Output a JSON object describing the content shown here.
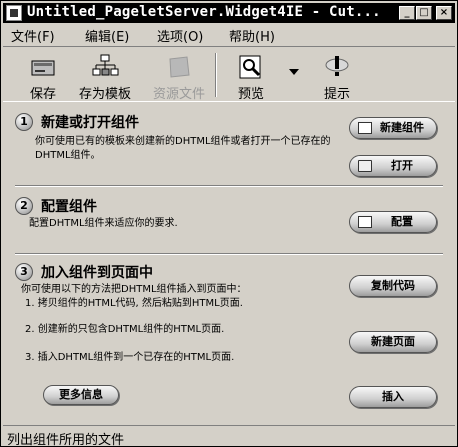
{
  "window": {
    "title": "Untitled_PageletServer.Widget4IE - Cut...",
    "minimize": "_",
    "maximize": "□",
    "close": "×"
  },
  "menu": [
    {
      "label": "文件(F)"
    },
    {
      "label": "编辑(E)"
    },
    {
      "label": "选项(O)"
    },
    {
      "label": "帮助(H)"
    }
  ],
  "toolbar": {
    "save": "保存",
    "save_as_template": "存为模板",
    "resource_file": "资源文件",
    "preview": "预览",
    "hint": "提示"
  },
  "sections": [
    {
      "num": "1",
      "title": "新建或打开组件",
      "desc": "你可使用已有的模板来创建新的DHTML组件或者打开一个已存在的DHTML组件。",
      "buttons": [
        "新建组件",
        "打开"
      ]
    },
    {
      "num": "2",
      "title": "配置组件",
      "desc": "配置DHTML组件来适应你的要求.",
      "buttons": [
        "配置"
      ]
    },
    {
      "num": "3",
      "title": "加入组件到页面中",
      "desc": "你可使用以下的方法把DHTML组件插入到页面中：",
      "steps": [
        "1. 拷贝组件的HTML代码, 然后粘贴到HTML页面.",
        "2. 创建新的只包含DHTML组件的HTML页面.",
        "3. 插入DHTML组件到一个已存在的HTML页面."
      ],
      "buttons": [
        "复制代码",
        "新建页面",
        "插入"
      ]
    }
  ],
  "more_info": "更多信息",
  "status": "列出组件所用的文件"
}
